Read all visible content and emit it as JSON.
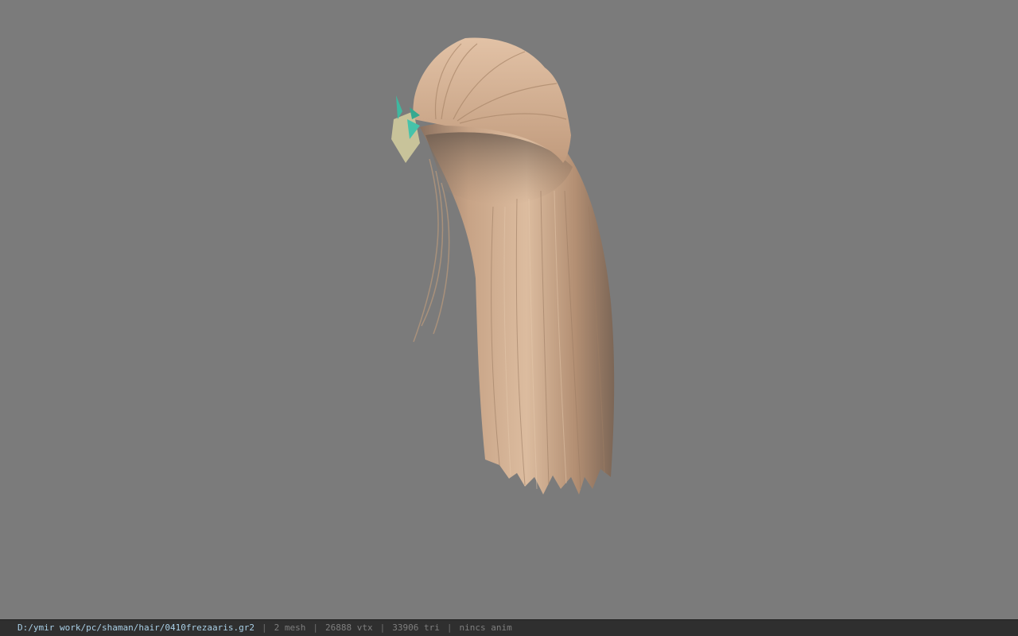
{
  "viewport": {
    "background": "#7b7b7b",
    "model": "hair-mesh",
    "hair_color": "#c9a382",
    "accessory_color": "#3fb8a0"
  },
  "status_bar": {
    "file_path": "D:/ymir work/pc/shaman/hair/0410frezaaris.gr2",
    "separator": "|",
    "mesh_count": "2 mesh",
    "vertex_count": "26888 vtx",
    "triangle_count": "33906 tri",
    "anim_status": "nincs anim"
  }
}
